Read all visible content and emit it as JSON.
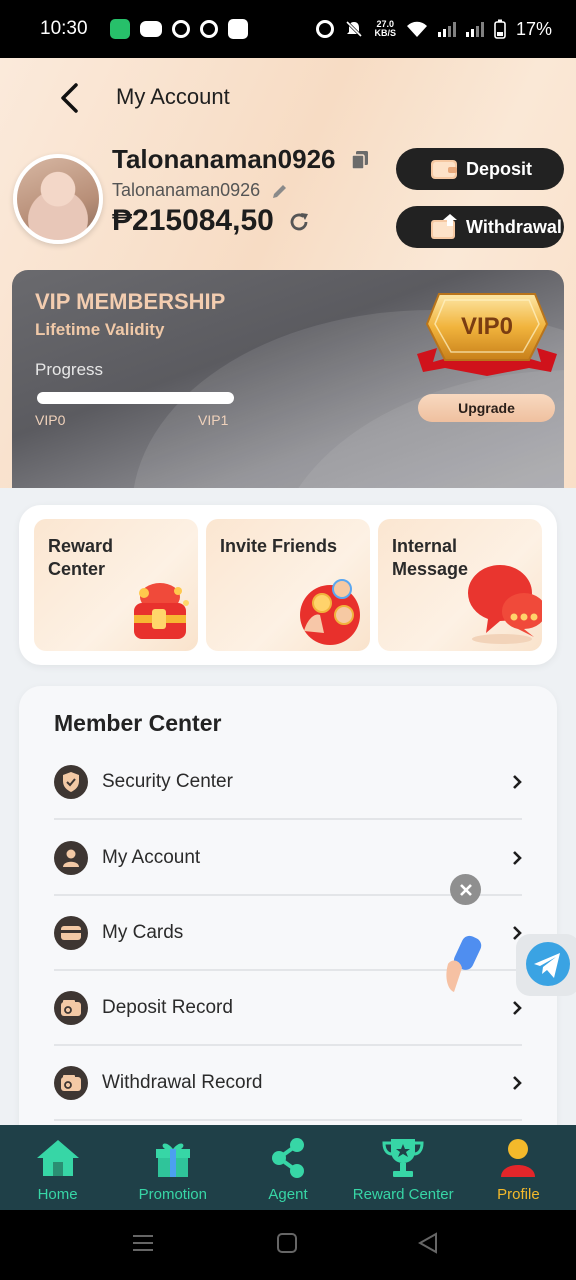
{
  "status_bar": {
    "time": "10:30",
    "net_speed_value": "27.0",
    "net_speed_unit": "KB/S",
    "battery": "17%"
  },
  "header": {
    "title": "My Account",
    "back_icon": "chevron-left-icon"
  },
  "profile": {
    "username": "Talonanaman0926",
    "subname": "Talonanaman0926",
    "balance": "₱215084,50",
    "deposit_label": "Deposit",
    "withdrawal_label": "Withdrawal"
  },
  "vip": {
    "title": "VIP MEMBERSHIP",
    "validity": "Lifetime Validity",
    "progress_label": "Progress",
    "progress_fraction": 0.0,
    "level_from": "VIP0",
    "level_to": "VIP1",
    "badge": "VIP0",
    "upgrade_label": "Upgrade"
  },
  "quick_cards": [
    {
      "label": "Reward\nCenter",
      "icon": "treasure-chest-icon"
    },
    {
      "label": "Invite Friends",
      "icon": "invite-friends-icon"
    },
    {
      "label": "Internal\nMessage",
      "icon": "chat-bubble-icon"
    }
  ],
  "member_center": {
    "title": "Member Center",
    "items": [
      {
        "label": "Security Center",
        "icon": "shield-icon"
      },
      {
        "label": "My Account",
        "icon": "user-icon"
      },
      {
        "label": "My Cards",
        "icon": "card-icon"
      },
      {
        "label": "Deposit Record",
        "icon": "wallet-icon"
      },
      {
        "label": "Withdrawal Record",
        "icon": "wallet-icon"
      }
    ]
  },
  "bottom_nav": [
    {
      "label": "Home",
      "icon": "home-icon"
    },
    {
      "label": "Promotion",
      "icon": "gift-icon"
    },
    {
      "label": "Agent",
      "icon": "share-icon"
    },
    {
      "label": "Reward Center",
      "icon": "trophy-icon"
    },
    {
      "label": "Profile",
      "icon": "profile-icon"
    }
  ],
  "colors": {
    "nav_bg": "#1f4048",
    "nav_accent": "#37d6a6",
    "profile_accent": "#f3b92b",
    "vip_gold": "#f3cdb0"
  }
}
